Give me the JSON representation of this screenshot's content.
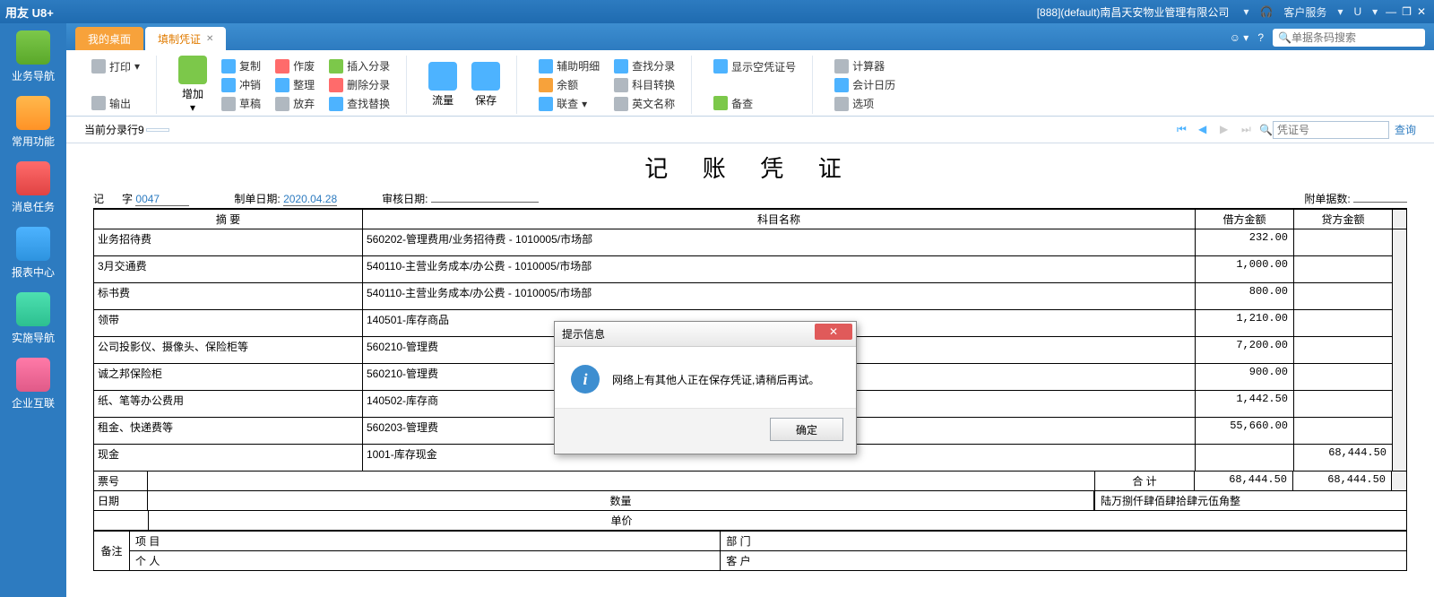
{
  "titlebar": {
    "brand": "用友 U8+",
    "org": "[888](default)南昌天安物业管理有限公司",
    "service": "客户服务",
    "u": "U"
  },
  "sidebar": {
    "items": [
      {
        "label": "业务导航"
      },
      {
        "label": "常用功能"
      },
      {
        "label": "消息任务"
      },
      {
        "label": "报表中心"
      },
      {
        "label": "实施导航"
      },
      {
        "label": "企业互联"
      }
    ]
  },
  "tabs": {
    "desktop": "我的桌面",
    "voucher": "填制凭证"
  },
  "search": {
    "placeholder": "单据条码搜索"
  },
  "ribbon": {
    "print": "打印",
    "export": "输出",
    "add": "增加",
    "copy": "复制",
    "offset": "冲销",
    "draft": "草稿",
    "invalid": "作废",
    "arrange": "整理",
    "abandon": "放弃",
    "insert_entry": "插入分录",
    "delete_entry": "删除分录",
    "find_replace": "查找替换",
    "flow": "流量",
    "save": "保存",
    "aux_detail": "辅助明细",
    "balance": "余额",
    "link_check": "联查",
    "search_entry": "查找分录",
    "subj_convert": "科目转换",
    "en_name": "英文名称",
    "show_empty": "显示空凭证号",
    "note": "备查",
    "calc": "计算器",
    "acc_calendar": "会计日历",
    "options": "选项"
  },
  "infobar": {
    "label": "当前分录行",
    "row": "9",
    "badge": "",
    "nav_placeholder": "凭证号",
    "query": "查询"
  },
  "voucher": {
    "title": "记 账 凭 证",
    "zi": "记",
    "zi_suffix": "字",
    "number": "0047",
    "make_date_label": "制单日期:",
    "make_date": "2020.04.28",
    "audit_date_label": "审核日期:",
    "audit_date": "",
    "attach_label": "附单据数:",
    "attach": ""
  },
  "columns": {
    "summary": "摘  要",
    "subject": "科目名称",
    "debit": "借方金额",
    "credit": "贷方金额"
  },
  "rows": [
    {
      "summary": "业务招待费",
      "subject": "560202-管理费用/业务招待费 - 1010005/市场部",
      "debit": "232.00",
      "credit": ""
    },
    {
      "summary": "3月交通费",
      "subject": "540110-主营业务成本/办公费 - 1010005/市场部",
      "debit": "1,000.00",
      "credit": ""
    },
    {
      "summary": "标书费",
      "subject": "540110-主营业务成本/办公费 - 1010005/市场部",
      "debit": "800.00",
      "credit": ""
    },
    {
      "summary": "领带",
      "subject": "140501-库存商品",
      "debit": "1,210.00",
      "credit": ""
    },
    {
      "summary": "公司投影仪、摄像头、保险柜等",
      "subject": "560210-管理费",
      "debit": "7,200.00",
      "credit": ""
    },
    {
      "summary": "诚之邦保险柜",
      "subject": "560210-管理费",
      "debit": "900.00",
      "credit": ""
    },
    {
      "summary": "纸、笔等办公费用",
      "subject": "140502-库存商",
      "debit": "1,442.50",
      "credit": ""
    },
    {
      "summary": "租金、快递费等",
      "subject": "560203-管理费",
      "debit": "55,660.00",
      "credit": ""
    },
    {
      "summary": "现金",
      "subject": "1001-库存现金",
      "debit": "",
      "credit": "68,444.50"
    }
  ],
  "footer": {
    "bill_no": "票号",
    "date": "日期",
    "qty": "数量",
    "price": "单价",
    "total": "合  计",
    "debit_total": "68,444.50",
    "credit_total": "68,444.50",
    "cn_amount": "陆万捌仟肆佰肆拾肆元伍角整",
    "remark": "备注",
    "project": "项  目",
    "dept": "部  门",
    "person": "个  人",
    "customer": "客  户"
  },
  "dialog": {
    "title": "提示信息",
    "message": "网络上有其他人正在保存凭证,请稍后再试。",
    "ok": "确定"
  }
}
